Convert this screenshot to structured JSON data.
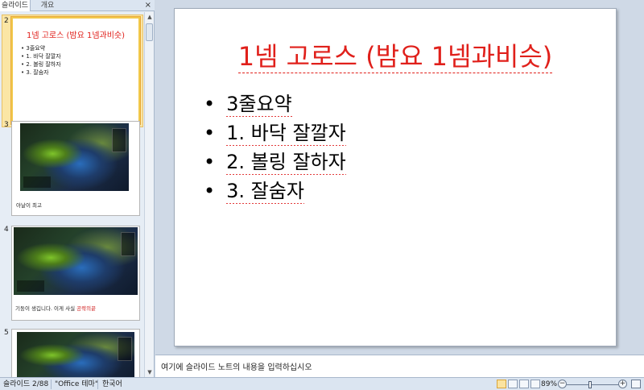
{
  "left_pane": {
    "tabs": [
      "슬라이드",
      "개요"
    ],
    "close_glyph": "×",
    "thumbnails": [
      {
        "number": "2",
        "title": "1넴 고로스 (밤요 1넴과비슷)",
        "bullets": [
          "3줄요약",
          "1. 바닥 잘깔자",
          "2. 볼링 잘하자",
          "3. 잘숨자"
        ],
        "selected": true
      },
      {
        "number": "3",
        "caption": "아날이 최고",
        "selected": false
      },
      {
        "number": "4",
        "caption_normal": "기둥이 생깁니다. 이게 사실 ",
        "caption_red": "공략의끝",
        "selected": false
      },
      {
        "number": "5",
        "selected": false
      }
    ]
  },
  "slide": {
    "title": "1넴 고로스 (밤요 1넴과비슷)",
    "bullets": [
      "3줄요약",
      "1. 바닥 잘깔자",
      "2. 볼링 잘하자",
      "3. 잘숨자"
    ]
  },
  "notes": {
    "placeholder": "여기에 슬라이드 노트의 내용을 입력하십시오"
  },
  "status_bar": {
    "slide_indicator": "슬라이드 2/88",
    "theme": "\"Office 테마\"",
    "language": "한국어",
    "zoom": "89%"
  },
  "colors": {
    "title_red": "#e0201b",
    "selection_gold": "#f2c94c",
    "chrome_blue": "#dbe5f1"
  }
}
